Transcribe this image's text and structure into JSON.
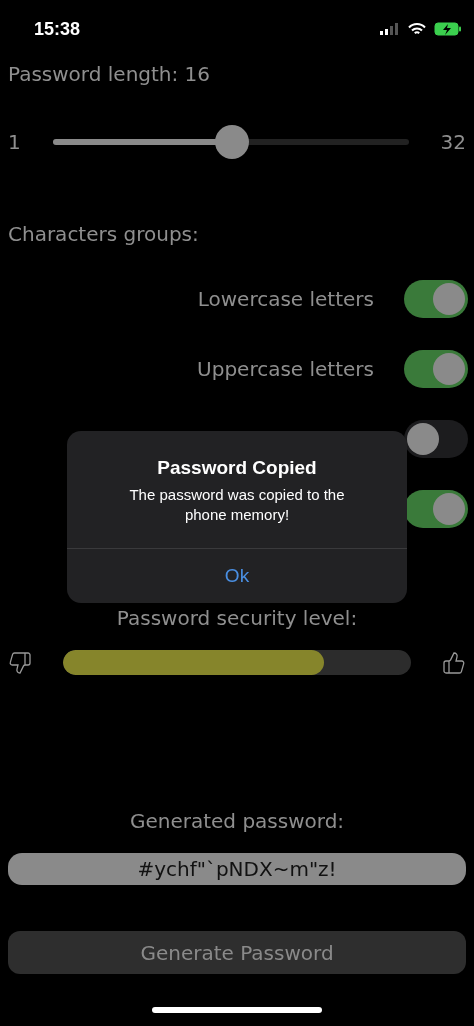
{
  "status_bar": {
    "time": "15:38"
  },
  "length": {
    "label": "Password length: 16",
    "min": "1",
    "max": "32",
    "level": 0.505
  },
  "groups": {
    "title": "Characters groups:",
    "items": [
      {
        "label": "Lowercase letters",
        "on": true
      },
      {
        "label": "Uppercase letters",
        "on": true
      },
      {
        "on": false
      },
      {
        "on": true
      }
    ]
  },
  "security": {
    "label": "Password security level:",
    "level": 0.75
  },
  "generated": {
    "label": "Generated password:",
    "value": "#ychf\"`pNDX~m\"z!"
  },
  "generate_button": "Generate Password",
  "alert": {
    "title": "Password Copied",
    "message": "The password was copied to the phone memory!",
    "button": "Ok"
  }
}
